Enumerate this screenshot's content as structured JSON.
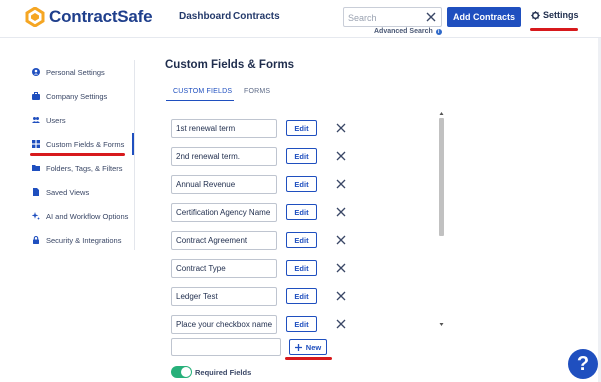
{
  "header": {
    "brand": "ContractSafe",
    "nav": [
      "Dashboard",
      "Contracts"
    ],
    "search_placeholder": "Search",
    "advanced_search": "Advanced Search",
    "add_contracts": "Add Contracts",
    "settings": "Settings"
  },
  "sidebar": {
    "items": [
      {
        "label": "Personal Settings",
        "icon": "user-circle-icon"
      },
      {
        "label": "Company Settings",
        "icon": "briefcase-icon"
      },
      {
        "label": "Users",
        "icon": "users-icon"
      },
      {
        "label": "Custom Fields & Forms",
        "icon": "grid-icon",
        "active": true
      },
      {
        "label": "Folders, Tags, & Filters",
        "icon": "folder-icon"
      },
      {
        "label": "Saved Views",
        "icon": "file-icon"
      },
      {
        "label": "AI and Workflow Options",
        "icon": "sparkle-icon"
      },
      {
        "label": "Security & Integrations",
        "icon": "lock-icon"
      }
    ]
  },
  "main": {
    "title": "Custom Fields & Forms",
    "tabs": [
      {
        "label": "CUSTOM FIELDS",
        "active": true
      },
      {
        "label": "FORMS",
        "active": false
      }
    ],
    "fields": [
      "1st renewal term",
      "2nd renewal term.",
      "Annual Revenue",
      "Certification Agency Name",
      "Contract Agreement",
      "Contract Type",
      "Ledger Test",
      "Place your checkbox name"
    ],
    "edit_label": "Edit",
    "new_label": "New",
    "new_input_value": "",
    "required_fields_label": "Required Fields",
    "required_fields_on": true
  },
  "help": "?",
  "colors": {
    "brand_blue": "#1f4fbf",
    "logo_orange": "#f5a623",
    "toggle_green": "#27b07a",
    "annotation_red": "#d7191c"
  }
}
